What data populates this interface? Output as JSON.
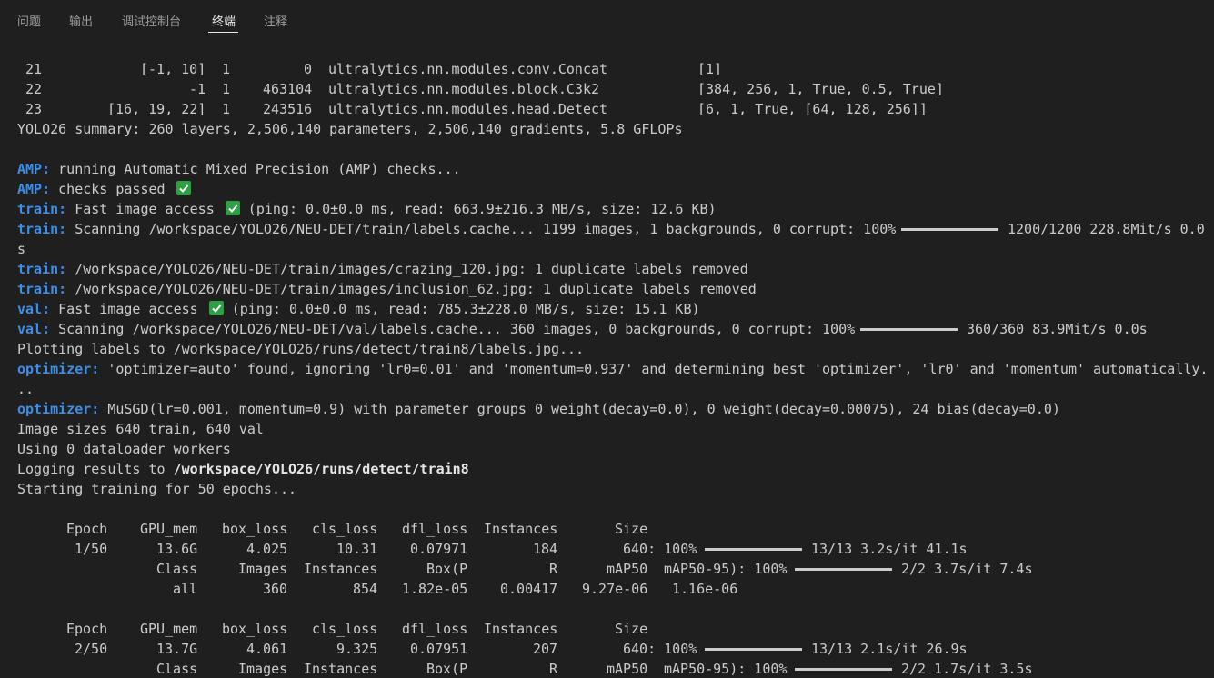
{
  "panel": {
    "tabs": [
      {
        "label": "问题"
      },
      {
        "label": "输出"
      },
      {
        "label": "调试控制台"
      },
      {
        "label": "终端"
      },
      {
        "label": "注释"
      }
    ]
  },
  "terminal": {
    "layers": [
      {
        "idx": "21",
        "from": "[-1, 10]",
        "n": "1",
        "params": "0",
        "module": "ultralytics.nn.modules.conv.Concat",
        "args": "[1]"
      },
      {
        "idx": "22",
        "from": "-1",
        "n": "1",
        "params": "463104",
        "module": "ultralytics.nn.modules.block.C3k2",
        "args": "[384, 256, 1, True, 0.5, True]"
      },
      {
        "idx": "23",
        "from": "[16, 19, 22]",
        "n": "1",
        "params": "243516",
        "module": "ultralytics.nn.modules.head.Detect",
        "args": "[6, 1, True, [64, 128, 256]]"
      }
    ],
    "summary": "YOLO26 summary: 260 layers, 2,506,140 parameters, 2,506,140 gradients, 5.8 GFLOPs",
    "amp1": {
      "key": "AMP:",
      "text": " running Automatic Mixed Precision (AMP) checks..."
    },
    "amp2": {
      "key": "AMP:",
      "text": " checks passed"
    },
    "train1": {
      "key": "train:",
      "text": " Fast image access",
      "text2": " (ping: 0.0±0.0 ms, read: 663.9±216.3 MB/s, size: 12.6 KB)"
    },
    "train2": {
      "key": "train:",
      "text": " Scanning /workspace/YOLO26/NEU-DET/train/labels.cache... 1199 images, 1 backgrounds, 0 corrupt: 100%",
      "progress": 1.0,
      "text2": "1200/1200 228.8Mit/s 0.0",
      "wrap": "s"
    },
    "train3": {
      "key": "train:",
      "text": " /workspace/YOLO26/NEU-DET/train/images/crazing_120.jpg: 1 duplicate labels removed"
    },
    "train4": {
      "key": "train:",
      "text": " /workspace/YOLO26/NEU-DET/train/images/inclusion_62.jpg: 1 duplicate labels removed"
    },
    "val1": {
      "key": "val:",
      "text": " Fast image access",
      "text2": " (ping: 0.0±0.0 ms, read: 785.3±228.0 MB/s, size: 15.1 KB)"
    },
    "val2": {
      "key": "val:",
      "text": " Scanning /workspace/YOLO26/NEU-DET/val/labels.cache... 360 images, 0 backgrounds, 0 corrupt: 100%",
      "progress": 1.0,
      "text2": "360/360 83.9Mit/s 0.0s"
    },
    "plotting": "Plotting labels to /workspace/YOLO26/runs/detect/train8/labels.jpg...",
    "opt1": {
      "key": "optimizer:",
      "text": " 'optimizer=auto' found, ignoring 'lr0=0.01' and 'momentum=0.937' and determining best 'optimizer', 'lr0' and 'momentum' automatically.",
      "wrap": ".."
    },
    "opt2": {
      "key": "optimizer:",
      "text": " MuSGD(lr=0.001, momentum=0.9) with parameter groups 0 weight(decay=0.0), 0 weight(decay=0.00075), 24 bias(decay=0.0)"
    },
    "imgsizes": "Image sizes 640 train, 640 val",
    "workers": "Using 0 dataloader workers",
    "logging": {
      "text": "Logging results to ",
      "path": "/workspace/YOLO26/runs/detect/train8"
    },
    "starting": "Starting training for 50 epochs...",
    "train_header": [
      "Epoch",
      "GPU_mem",
      "box_loss",
      "cls_loss",
      "dfl_loss",
      "Instances",
      "Size"
    ],
    "val_header": [
      "Class",
      "Images",
      "Instances",
      "Box(P",
      "R",
      "mAP50",
      "mAP50-95): 100%"
    ],
    "epochs": [
      {
        "train": [
          "1/50",
          "13.6G",
          "4.025",
          "10.31",
          "0.07971",
          "184",
          "640: 100%"
        ],
        "train_progress": 1.0,
        "train_tail": "13/13 3.2s/it 41.1s",
        "val_progress": 1.0,
        "val_tail": "2/2 3.7s/it 7.4s",
        "val_result": [
          "all",
          "360",
          "854",
          "1.82e-05",
          "0.00417",
          "9.27e-06",
          "1.16e-06"
        ]
      },
      {
        "train": [
          "2/50",
          "13.7G",
          "4.061",
          "9.325",
          "0.07951",
          "207",
          "640: 100%"
        ],
        "train_progress": 1.0,
        "train_tail": "13/13 2.1s/it 26.9s",
        "val_progress": 1.0,
        "val_tail": "2/2 1.7s/it 3.5s"
      }
    ]
  }
}
